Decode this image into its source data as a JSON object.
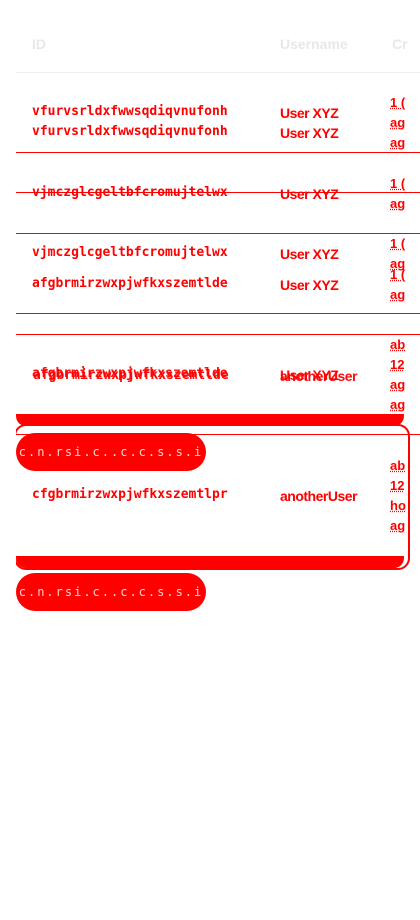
{
  "table": {
    "headers": {
      "id": "ID",
      "username": "Username",
      "created": "Cr"
    },
    "rows": [
      {
        "ids": [
          "vfurvsrldxfwwsqdiqvnufonh",
          "vfurvsrldxfwwsqdiqvnufonh"
        ],
        "users": [
          "User XYZ",
          "User XYZ"
        ],
        "created": [
          "1 (",
          "ag",
          "ag"
        ]
      },
      {
        "ids": [
          "vjmczglcgeltbfcromujtelwx"
        ],
        "users": [
          "User XYZ"
        ],
        "created": [
          "1 (",
          "ag"
        ]
      },
      {
        "ids": [
          "vjmczglcgeltbfcromujtelwx",
          "afgbrmirzwxpjwfkxszemtlde"
        ],
        "users": [
          "User XYZ",
          "User XYZ"
        ],
        "created": [
          "1 (",
          "ag",
          "1 (",
          "ag"
        ]
      },
      {
        "ids": [
          "afgbrmirzwxpjwfkxszemtlde",
          "afgbrmirzwxpjwfkxszemtlde"
        ],
        "users": [
          "User XYZ",
          "anotherUser"
        ],
        "created": [
          "ab",
          "12",
          "ag",
          "ag"
        ]
      },
      {
        "ids": [
          "cfgbrmirzwxpjwfkxszemtlpr"
        ],
        "users": [
          "anotherUser"
        ],
        "created": [
          "ab",
          "12",
          "ho",
          "ag"
        ]
      }
    ]
  },
  "pills": [
    {
      "label": "c.n.rsi.c..c.c.s.s.i"
    },
    {
      "label": "c.n.rsi.c..c.c.s.s.i"
    }
  ]
}
